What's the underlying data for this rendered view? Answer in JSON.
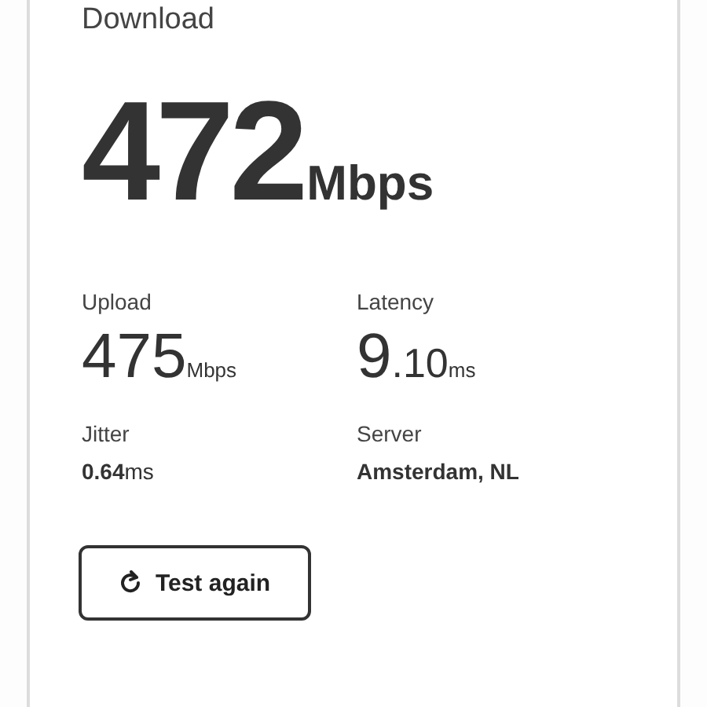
{
  "download": {
    "label": "Download",
    "value": "472",
    "unit": "Mbps"
  },
  "stats": [
    {
      "label": "Upload",
      "kind": "large",
      "value": "475",
      "unit": "Mbps"
    },
    {
      "label": "Latency",
      "kind": "large",
      "value": "9",
      "fraction": ".10",
      "unit": "ms"
    },
    {
      "label": "Jitter",
      "kind": "small",
      "value": "0.64",
      "unit": "ms"
    },
    {
      "label": "Server",
      "kind": "small",
      "value": "Amsterdam, NL"
    }
  ],
  "button": {
    "label": "Test again"
  }
}
